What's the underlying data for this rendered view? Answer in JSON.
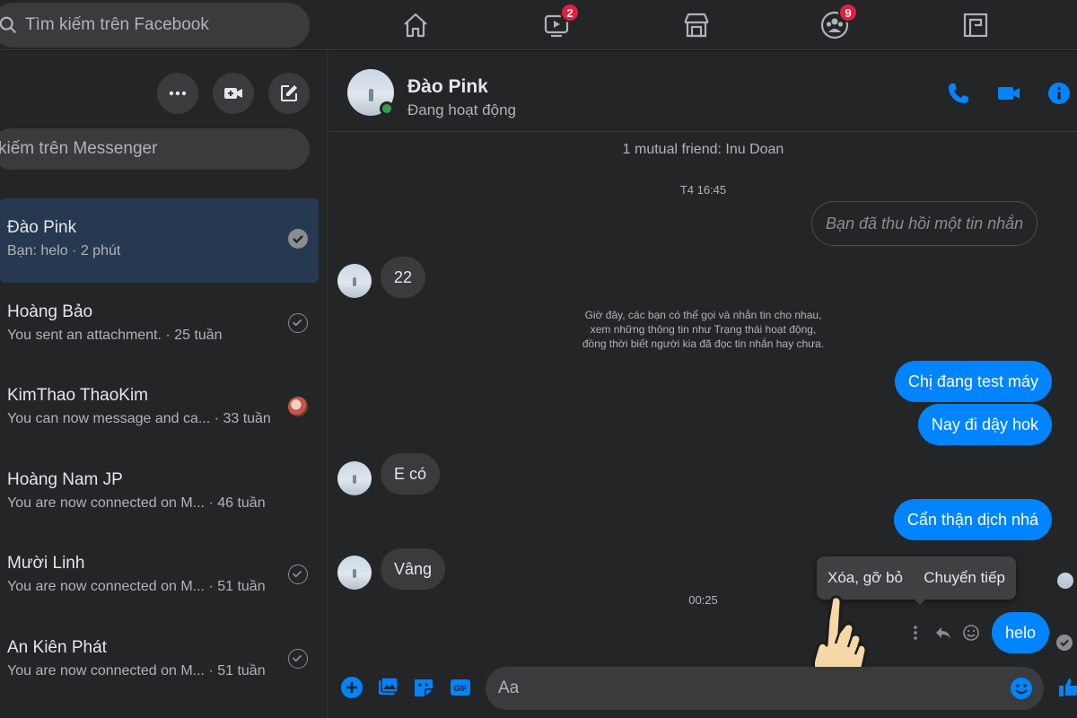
{
  "topbar": {
    "search_placeholder": "Tìm kiếm trên Facebook",
    "nav": [
      {
        "icon": "home-icon",
        "badge": ""
      },
      {
        "icon": "watch-icon",
        "badge": "2"
      },
      {
        "icon": "marketplace-icon",
        "badge": ""
      },
      {
        "icon": "groups-icon",
        "badge": "9"
      },
      {
        "icon": "gaming-icon",
        "badge": ""
      }
    ]
  },
  "sidebar": {
    "actions": [
      "more-icon",
      "new-room-icon",
      "compose-icon"
    ],
    "search_placeholder": "kiếm trên Messenger",
    "conversations": [
      {
        "name": "Đào Pink",
        "preview": "Bạn: helo · 2 phút",
        "status": "seen-filled",
        "active": true
      },
      {
        "name": "Hoàng Bảo",
        "preview": "You sent an attachment. · 25 tuần",
        "status": "sent",
        "active": false
      },
      {
        "name": "KimThao ThaoKim",
        "preview": "You can now message and ca... · 33 tuần",
        "status": "avatar",
        "active": false
      },
      {
        "name": "Hoàng Nam JP",
        "preview": "You are now connected on M... · 46 tuần",
        "status": "",
        "active": false
      },
      {
        "name": "Mười Linh",
        "preview": "You are now connected on M... · 51 tuần",
        "status": "sent",
        "active": false
      },
      {
        "name": "An Kiên Phát",
        "preview": "You are now connected on M... · 51 tuần",
        "status": "sent",
        "active": false
      }
    ]
  },
  "chat": {
    "contact_name": "Đào Pink",
    "contact_status": "Đang hoạt động",
    "mutual_friend": "1 mutual friend: Inu Doan",
    "time1": "T4 16:45",
    "unsent": "Bạn đã thu hồi một tin nhắn",
    "msg_22": "22",
    "notice": [
      "Giờ đây, các bạn có thể gọi và nhắn tin cho nhau,",
      "xem những thông tin như Trạng thái hoạt động,",
      "đồng thời biết người kia đã đọc tin nhắn hay chưa."
    ],
    "out1": "Chị đang test máy",
    "out2": "Nay đi dậy hok",
    "in_eco": "E có",
    "out3": "Cẩn thận dịch nhá",
    "in_vang": "Vâng",
    "time2": "00:25",
    "tooltip_delete": "Xóa, gỡ bỏ",
    "tooltip_forward": "Chuyển tiếp",
    "out_helo": "helo",
    "composer_placeholder": "Aa"
  },
  "colors": {
    "accent": "#0084ff",
    "background": "#18191a",
    "panel": "#242526",
    "badge": "#e41e3f",
    "online": "#31a24c"
  }
}
